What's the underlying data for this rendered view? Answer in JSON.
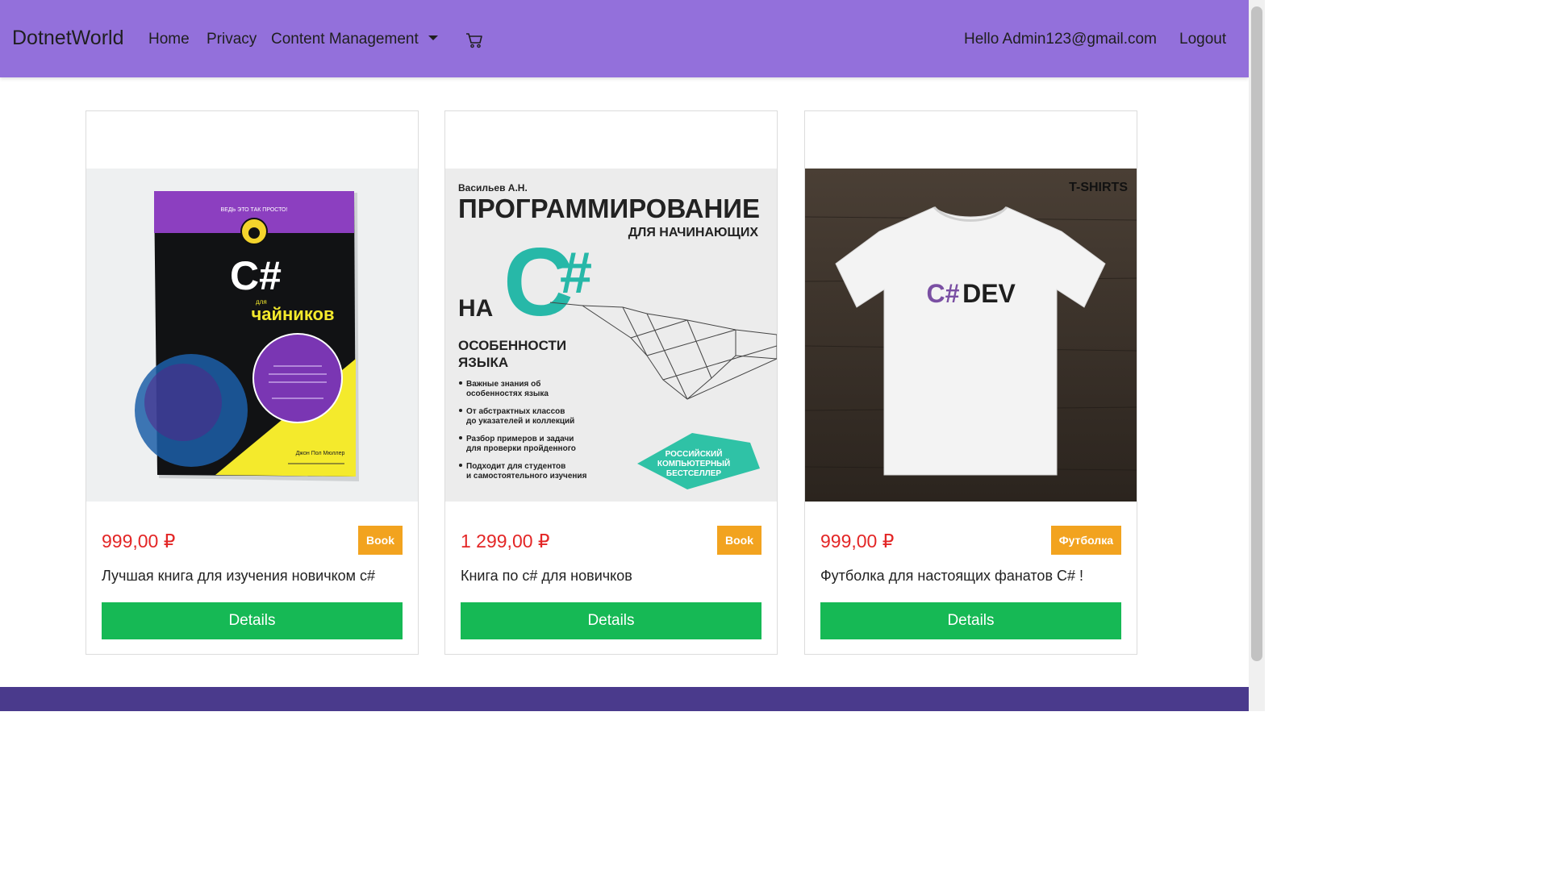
{
  "navbar": {
    "brand": "DotnetWorld",
    "links": [
      {
        "label": "Home"
      },
      {
        "label": "Privacy"
      },
      {
        "label": "Content Management"
      }
    ],
    "cart_icon": "shopping-cart-icon",
    "greeting": "Hello Admin123@gmail.com",
    "logout": "Logout"
  },
  "colors": {
    "navbar_bg": "#9370db",
    "price": "#e32626",
    "badge": "#f2a31f",
    "button": "#16b955",
    "footer": "#4a3a8c"
  },
  "products": [
    {
      "price": "999,00 ₽",
      "badge": "Book",
      "title": "Лучшая книга для изучения новичком c#",
      "button": "Details",
      "image": {
        "top": "ВЕДЬ ЭТО ТАК ПРОСТО!",
        "main": "C#",
        "sub": "для",
        "brand": "чайников",
        "author": "Джон Пол Мюллер"
      }
    },
    {
      "price": "1 299,00 ₽",
      "badge": "Book",
      "title": "Книга по c# для новичков",
      "button": "Details",
      "image": {
        "author": "Васильев А.Н.",
        "headline": "ПРОГРАММИРОВАНИЕ",
        "sub": "ДЛЯ НАЧИНАЮЩИХ",
        "na": "НА",
        "c": "C",
        "sharp": "#",
        "section": "ОСОБЕННОСТИ",
        "section2": "ЯЗЫКА",
        "bullets": [
          "Важные знания об",
          "особенностях языка",
          "От абстрактных классов",
          "до указателей и коллекций",
          "Разбор примеров и задачи",
          "для проверки пройденного",
          "Подходит для студентов",
          "и самостоятельного изучения"
        ],
        "stamp1": "РОССИЙСКИЙ",
        "stamp2": "КОМПЬЮТЕРНЫЙ",
        "stamp3": "БЕСТСЕЛЛЕР"
      }
    },
    {
      "price": "999,00 ₽",
      "badge": "Футболка",
      "title": "Футболка для настоящих фанатов C# !",
      "button": "Details",
      "image": {
        "logo": "T-SHIRTS",
        "shirt_c": "C#",
        "shirt_dev": "DEV"
      }
    }
  ]
}
